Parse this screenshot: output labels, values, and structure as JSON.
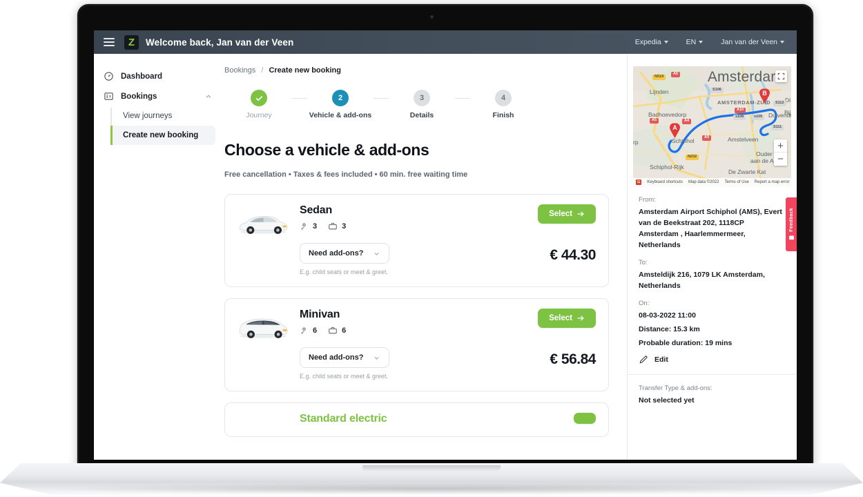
{
  "topbar": {
    "menu_icon": "hamburger-icon",
    "logo_letter": "Z",
    "welcome": "Welcome back, Jan van der Veen",
    "right_items": [
      {
        "label": "Expedia"
      },
      {
        "label": "EN"
      },
      {
        "label": "Jan van der Veen"
      }
    ]
  },
  "sidebar": {
    "items": [
      {
        "label": "Dashboard",
        "icon": "speedometer-icon"
      },
      {
        "label": "Bookings",
        "icon": "bookings-icon"
      }
    ],
    "sub_items": [
      {
        "label": "View journeys",
        "active": false
      },
      {
        "label": "Create new booking",
        "active": true
      }
    ]
  },
  "breadcrumb": {
    "parent": "Bookings",
    "separator": "/",
    "current": "Create new booking"
  },
  "stepper": {
    "steps": [
      {
        "num": "✓",
        "label": "Journey",
        "state": "done"
      },
      {
        "num": "2",
        "label": "Vehicle & add-ons",
        "state": "current"
      },
      {
        "num": "3",
        "label": "Details",
        "state": "todo"
      },
      {
        "num": "4",
        "label": "Finish",
        "state": "todo"
      }
    ]
  },
  "main": {
    "title": "Choose a vehicle & add-ons",
    "subtitle": "Free cancellation • Taxes & fees included • 60 min. free waiting time",
    "vehicles": [
      {
        "name": "Sedan",
        "passengers": "3",
        "luggage": "3",
        "addons_label": "Need add-ons?",
        "addons_hint": "E.g. child seats or meet & greet.",
        "select_label": "Select",
        "price": "€ 44.30",
        "image": "sedan-car-image"
      },
      {
        "name": "Minivan",
        "passengers": "6",
        "luggage": "6",
        "addons_label": "Need add-ons?",
        "addons_hint": "E.g. child seats or meet & greet.",
        "select_label": "Select",
        "price": "€ 56.84",
        "image": "minivan-car-image"
      },
      {
        "name": "Standard electric",
        "passengers": "",
        "luggage": "",
        "addons_label": "",
        "addons_hint": "",
        "select_label": "",
        "price": "",
        "image": "electric-car-image"
      }
    ]
  },
  "rightpanel": {
    "map": {
      "city_label": "Amsterdam",
      "marker_a": "A",
      "marker_b": "B",
      "places": [
        "Lijnden",
        "Badhoevedorp",
        "Schiphol",
        "Schiphol-Rijk",
        "AMSTERDAM-ZUID",
        "Amstelveen",
        "Duivendrecht",
        "Ouder aan de A",
        "De Zwarte Kat",
        "Bij",
        "rp",
        "Di"
      ],
      "road_shields": [
        "N519",
        "A5",
        "A5",
        "A9",
        "S106",
        "s108",
        "s105",
        "S112",
        "S111",
        "N232"
      ],
      "zoom_in": "+",
      "zoom_out": "−",
      "attribution": [
        "Keyboard shortcuts",
        "Map data ©2022",
        "Terms of Use",
        "Report a map error"
      ],
      "google_badge": "G"
    },
    "from_label": "From:",
    "from_value": "Amsterdam Airport Schiphol (AMS), Evert van de Beekstraat 202, 1118CP Amsterdam , Haarlemmermeer, Netherlands",
    "to_label": "To:",
    "to_value": "Amsteldijk 216, 1079 LK Amsterdam, Netherlands",
    "on_label": "On:",
    "on_value_datetime": "08-03-2022 11:00",
    "on_value_distance": "Distance: 15.3 km",
    "on_value_duration": "Probable duration: 19 mins",
    "edit_label": "Edit",
    "transfer_label": "Transfer Type & add-ons:",
    "transfer_value": "Not selected yet"
  },
  "feedback": {
    "label": "Feedback"
  },
  "colors": {
    "accent_green": "#7dc242",
    "step_current_blue": "#1b8fb5",
    "header_dark": "#434e5b",
    "feedback_red": "#f0455e"
  }
}
